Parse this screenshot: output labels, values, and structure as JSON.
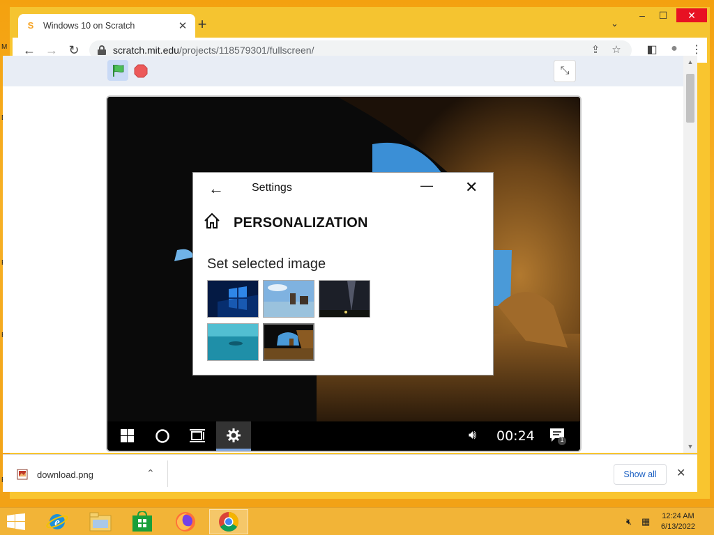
{
  "desktop": {
    "letters": [
      "M",
      "D",
      "R",
      "R",
      "R"
    ]
  },
  "browser": {
    "tab": {
      "title": "Windows 10 on Scratch",
      "close_glyph": "✕",
      "favicon_glyph": "S"
    },
    "new_tab_glyph": "+",
    "window_controls": {
      "minimize": "–",
      "maximize": "☐",
      "close": "✕"
    },
    "tab_search_glyph": "⌄",
    "nav": {
      "back": "←",
      "forward": "→",
      "reload": "↻"
    },
    "url": {
      "domain": "scratch.mit.edu",
      "path": "/projects/118579301/fullscreen/"
    },
    "toolbar_icons": {
      "share": "⇪",
      "bookmark": "☆",
      "side_panel": "◧",
      "profile": "●",
      "menu": "⋮"
    }
  },
  "scratch": {
    "unfullscreen_glyph": "⤡",
    "settings": {
      "back_glyph": "←",
      "title": "Settings",
      "minimize_glyph": "—",
      "close_glyph": "✕",
      "heading": "PERSONALIZATION",
      "subheading": "Set selected image",
      "thumbnails": [
        "windows-hero",
        "beach-rocks",
        "night-sky",
        "underwater",
        "cave-beach"
      ],
      "selected_thumbnail": "cave-beach"
    },
    "taskbar": {
      "clock": "00:24",
      "volume_glyph": "🔊︎",
      "notification_count": "1",
      "active_item": "settings"
    }
  },
  "downloads": {
    "file_name": "download.png",
    "chevron": "⌃",
    "show_all": "Show all",
    "close_glyph": "✕"
  },
  "os_taskbar": {
    "time": "12:24 AM",
    "date": "6/13/2022",
    "apps": [
      "internet-explorer",
      "file-explorer",
      "store",
      "firefox",
      "chrome"
    ],
    "active_app": "chrome"
  },
  "colors": {
    "desktop_orange": "#f6b423",
    "chrome_frame": "#f9c52f",
    "accent_blue": "#1a5fc2",
    "close_red": "#e81123",
    "scratch_green_flag": "#4cbf56",
    "scratch_stop": "#ec5959"
  }
}
